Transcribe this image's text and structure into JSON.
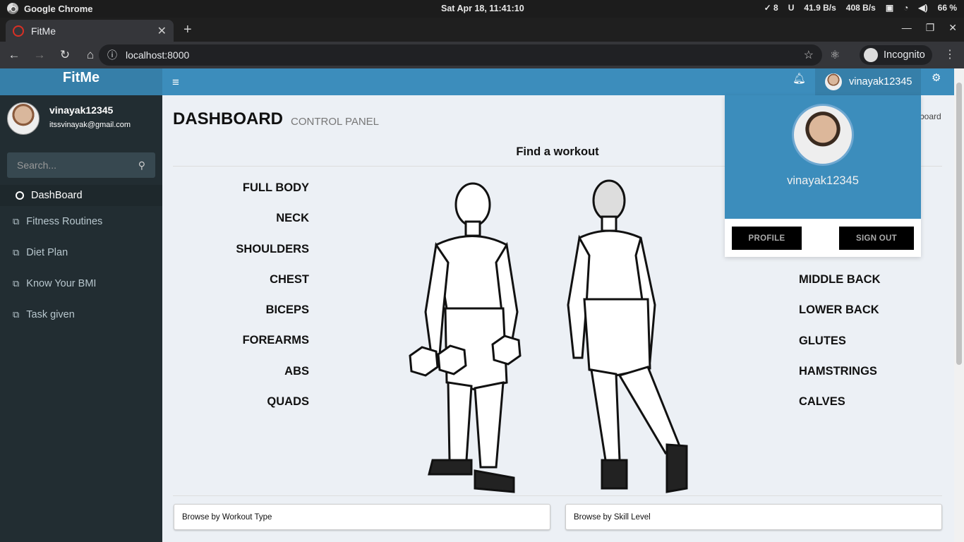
{
  "os": {
    "app_name": "Google Chrome",
    "clock": "Sat Apr 18, 11:41:10",
    "tray": [
      "✓ 8",
      "41.9 B/s",
      "408 B/s",
      "66 %"
    ]
  },
  "browser": {
    "tab_title": "FitMe",
    "url": "localhost:8000",
    "profile_label": "Incognito"
  },
  "sidebar": {
    "brand": "FitMe",
    "username": "vinayak12345",
    "email": "itssvinayak@gmail.com",
    "search_placeholder": "Search...",
    "items": [
      {
        "label": "DashBoard"
      },
      {
        "label": "Fitness Routines"
      },
      {
        "label": "Diet Plan"
      },
      {
        "label": "Know Your BMI"
      },
      {
        "label": "Task given"
      }
    ]
  },
  "topnav": {
    "username": "vinayak12345"
  },
  "main": {
    "title": "DASHBOARD",
    "subtitle": "CONTROL PANEL",
    "breadcrumb": "board",
    "find_heading": "Find a workout",
    "muscles_left": [
      "FULL BODY",
      "NECK",
      "SHOULDERS",
      "CHEST",
      "BICEPS",
      "FOREARMS",
      "ABS",
      "QUADS"
    ],
    "muscles_right": [
      "MIDDLE BACK",
      "LOWER BACK",
      "GLUTES",
      "HAMSTRINGS",
      "CALVES"
    ],
    "browse_workout_type": "Browse by Workout Type",
    "browse_skill_level": "Browse by Skill Level"
  },
  "user_dropdown": {
    "username": "vinayak12345",
    "profile_label": "PROFILE",
    "signout_label": "SIGN OUT"
  }
}
